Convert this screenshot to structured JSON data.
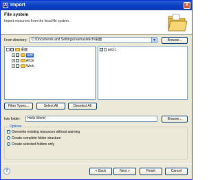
{
  "window": {
    "title": "Import",
    "title_icon": "import-app-icon",
    "close_label": "X"
  },
  "banner": {
    "title": "File system",
    "description": "Import resources from the local file system.",
    "graphic_icon": "open-folder-icon"
  },
  "from_directory": {
    "label": "From directory:",
    "value": "C:\\Documents and Settings\\rasmuslebch\\桌面",
    "browse_label": "Browse..."
  },
  "tree": {
    "items": [
      {
        "label": "桌面",
        "expander": "-",
        "checked": "grey"
      },
      {
        "label": "add",
        "expander": "+",
        "checked": "grey",
        "selected": true
      },
      {
        "label": "AICE",
        "expander": "+",
        "checked": "none"
      },
      {
        "label": "Work",
        "expander": "+",
        "checked": "none"
      }
    ]
  },
  "files": {
    "items": [
      {
        "label": "add.c",
        "checked": true
      }
    ]
  },
  "selection_buttons": {
    "filter_types": "Filter Types...",
    "select_all": "Select All",
    "deselect_all": "Deselect All"
  },
  "into_folder": {
    "label": "Into folder:",
    "value": "Hello World",
    "browse_label": "Browse..."
  },
  "options": {
    "title": "Options",
    "overwrite": "Overwrite existing resources without warning",
    "create_complete": "Create complete folder structure",
    "create_selected": "Create selected folders only"
  },
  "footer": {
    "help": "?",
    "back": "< Back",
    "next": "Next >",
    "finish": "Finish",
    "cancel": "Cancel"
  },
  "colors": {
    "title_bar": "#0a3fc2",
    "face": "#ece9d8",
    "selection": "#316ac5"
  }
}
